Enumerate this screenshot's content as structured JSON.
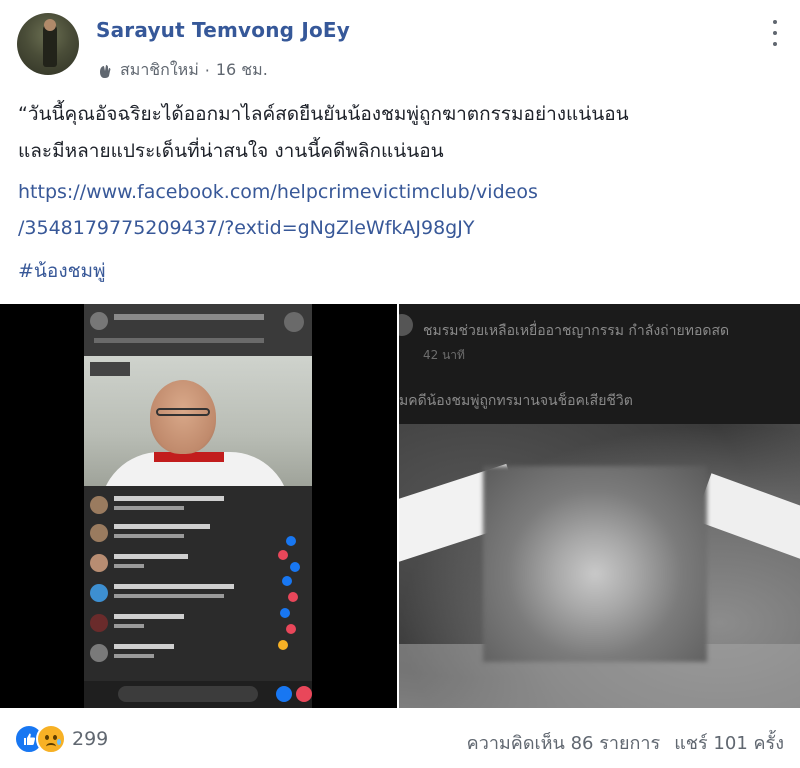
{
  "post": {
    "author": "Sarayut Temvong JoEy",
    "member_label": "สมาชิกใหม่",
    "separator": "·",
    "time": "16 ชม.",
    "text_line1": "“วันนี้คุณอัจฉริยะได้ออกมาไลค์สดยืนยันน้องชมพู่ถูกฆาตกรรมอย่างแน่นอน",
    "text_line2": "และมีหลายแประเด็นที่น่าสนใจ งานนี้คดีพลิกแน่นอน",
    "link_line1": "https://www.facebook.com/helpcrimevictimclub/videos",
    "link_line2": "/3548179775209437/?extid=gNgZleWfkAJ98gJY",
    "hashtag": "#น้องชมพู่"
  },
  "media_right": {
    "page_name": "ชมรมช่วยเหลือเหยื่ออาชญากรรม กำลังถ่ายทอดสด",
    "time": "42 นาที",
    "title": "มคดีน้องชมพู่ถูกทรมานจนช็อคเสียชีวิต"
  },
  "footer": {
    "reaction_count": "299",
    "comments": "ความคิดเห็น 86 รายการ",
    "shares": "แชร์ 101 ครั้ง"
  },
  "colors": {
    "author": "#365899",
    "link": "#385898",
    "like": "#1877f2",
    "sad": "#f7b125"
  }
}
